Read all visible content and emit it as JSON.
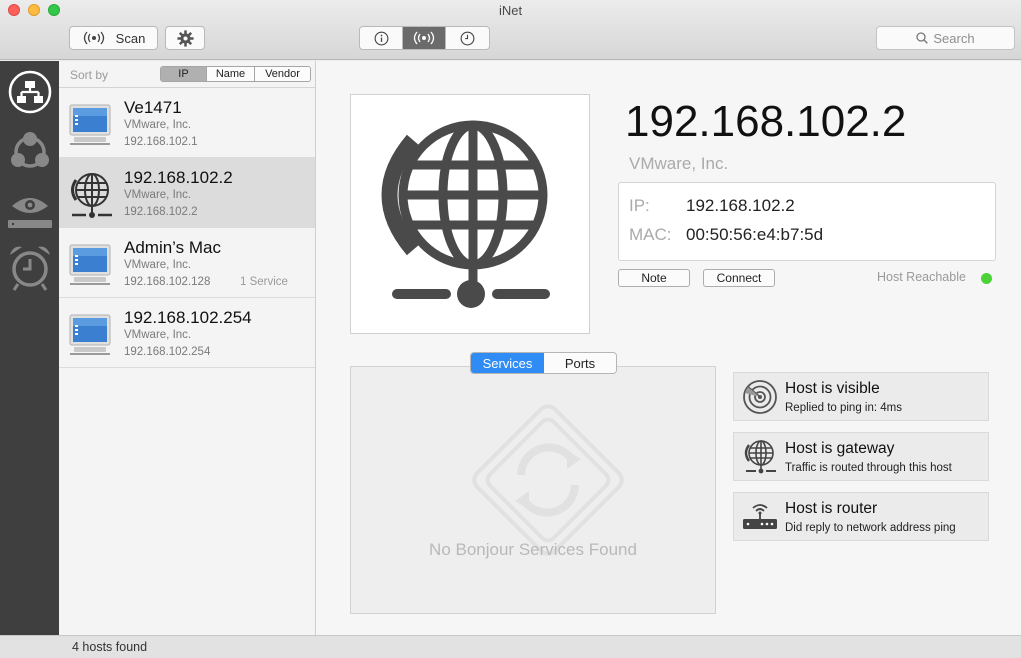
{
  "window": {
    "title": "iNet"
  },
  "toolbar": {
    "scan_label": "Scan",
    "search_placeholder": "Search"
  },
  "sidebar": {
    "items": [
      {
        "icon": "network-icon",
        "active": true
      },
      {
        "icon": "bonjour-icon",
        "active": false
      },
      {
        "icon": "eye-icon",
        "active": false
      },
      {
        "icon": "alarm-clock-icon",
        "active": false
      }
    ]
  },
  "list": {
    "sort_label": "Sort by",
    "sort_options": [
      "IP",
      "Name",
      "Vendor"
    ],
    "sort_selected": "IP",
    "hosts": [
      {
        "name": "Ve1471",
        "vendor": "VMware, Inc.",
        "ip": "192.168.102.1",
        "services": "",
        "icon": "computer-icon",
        "selected": false
      },
      {
        "name": "192.168.102.2",
        "vendor": "VMware, Inc.",
        "ip": "192.168.102.2",
        "services": "",
        "icon": "globe-icon",
        "selected": true
      },
      {
        "name": "Admin’s Mac",
        "vendor": "VMware, Inc.",
        "ip": "192.168.102.128",
        "services": "1 Service",
        "icon": "computer-icon",
        "selected": false
      },
      {
        "name": "192.168.102.254",
        "vendor": "VMware, Inc.",
        "ip": "192.168.102.254",
        "services": "",
        "icon": "computer-icon",
        "selected": false
      }
    ]
  },
  "detail": {
    "title": "192.168.102.2",
    "vendor": "VMware, Inc.",
    "ip_label": "IP:",
    "ip_value": "192.168.102.2",
    "mac_label": "MAC:",
    "mac_value": "00:50:56:e4:b7:5d",
    "note_label": "Note",
    "connect_label": "Connect",
    "reachability": "Host Reachable",
    "reachability_color": "#4cd137",
    "tabs": [
      "Services",
      "Ports"
    ],
    "active_tab": "Services",
    "empty_services": "No Bonjour Services Found",
    "statuses": [
      {
        "title": "Host is visible",
        "desc": "Replied to ping in: 4ms",
        "icon": "radar-icon"
      },
      {
        "title": "Host is gateway",
        "desc": "Traffic is routed through this host",
        "icon": "globe-icon"
      },
      {
        "title": "Host is router",
        "desc": "Did reply to network address ping",
        "icon": "router-icon"
      }
    ]
  },
  "statusbar": {
    "text": "4 hosts found"
  },
  "colors": {
    "accent": "#2f8cf4",
    "sidebar_bg": "#3f3f3f"
  }
}
